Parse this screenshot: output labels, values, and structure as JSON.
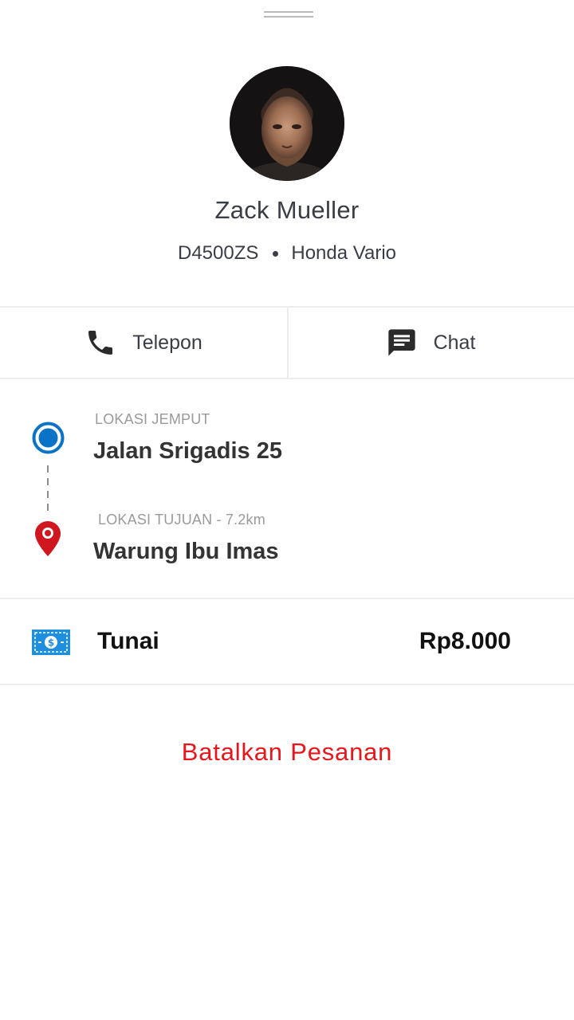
{
  "driver": {
    "name": "Zack Mueller",
    "plate": "D4500ZS",
    "vehicle": "Honda Vario"
  },
  "actions": {
    "call_label": "Telepon",
    "chat_label": "Chat"
  },
  "route": {
    "pickup_label": "LOKASI JEMPUT",
    "pickup_value": "Jalan Srigadis 25",
    "destination_label": "LOKASI TUJUAN - 7.2km",
    "destination_value": "Warung Ibu Imas"
  },
  "payment": {
    "method": "Tunai",
    "amount": "Rp8.000"
  },
  "cancel_label": "Batalkan Pesanan",
  "colors": {
    "pickup_blue": "#0a72c7",
    "destination_red": "#d0161f",
    "cancel_red": "#e8161b",
    "money_blue": "#1e8fe0"
  },
  "icons": {
    "call": "phone-icon",
    "chat": "chat-bubble-icon",
    "pickup": "pickup-location-icon",
    "destination": "destination-pin-icon",
    "payment": "cash-icon"
  }
}
